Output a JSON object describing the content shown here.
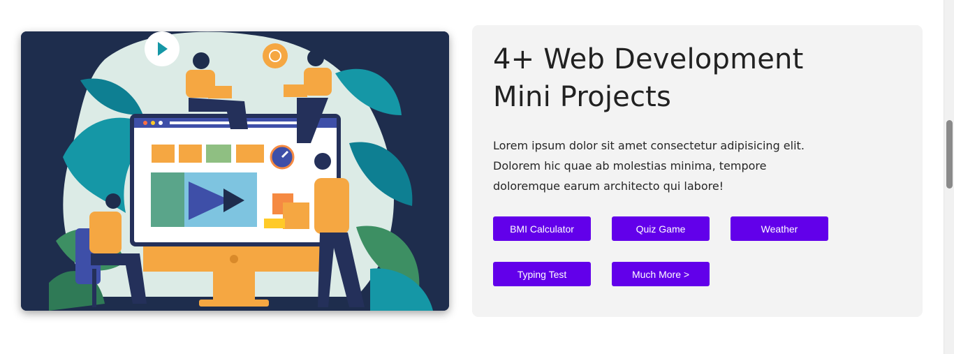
{
  "hero": {
    "image_alt": "Illustration of people working on web development around a large computer monitor",
    "background_color": "#1e2d4d"
  },
  "card": {
    "title_line1": "4+ Web Development",
    "title_line2": "Mini Projects",
    "description": "Lorem ipsum dolor sit amet consectetur adipisicing elit. Dolorem hic quae ab molestias minima, tempore doloremque earum architecto qui labore!",
    "buttons": [
      {
        "label": "BMI Calculator"
      },
      {
        "label": "Quiz Game"
      },
      {
        "label": "Weather"
      },
      {
        "label": "Typing Test"
      },
      {
        "label": "Much More >"
      }
    ],
    "button_color": "#6200ea",
    "background_color": "#f3f3f3"
  }
}
